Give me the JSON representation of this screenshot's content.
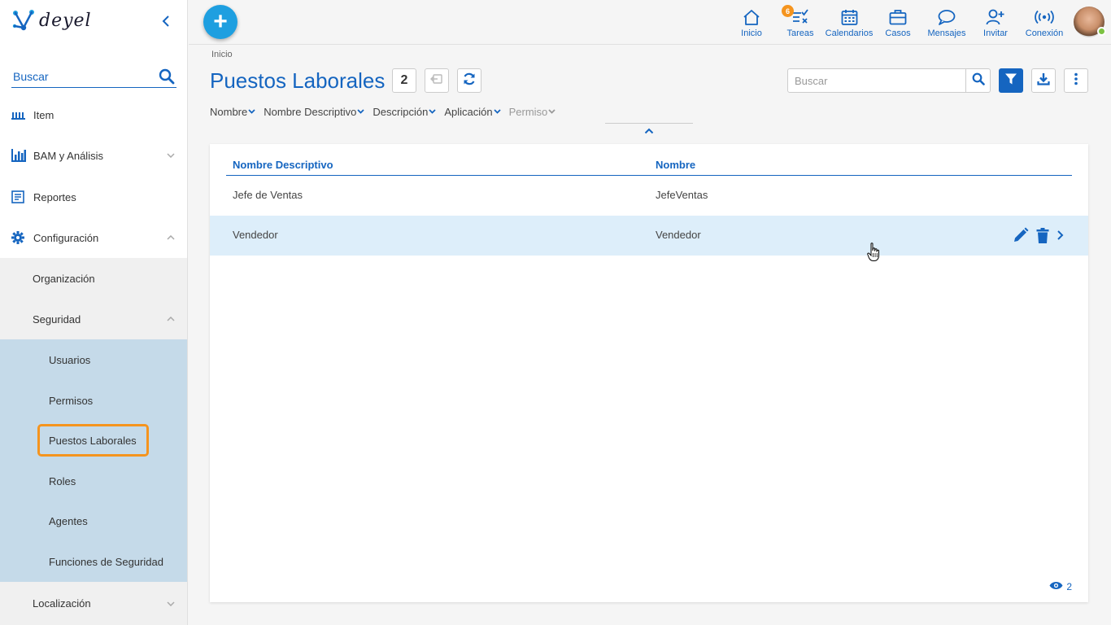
{
  "sidebar": {
    "logo_text": "deyel",
    "collapse_icon": "chevron-left-icon",
    "search_placeholder": "Buscar",
    "items": [
      {
        "label": "Item",
        "icon": "bars-icon"
      },
      {
        "label": "BAM y Análisis",
        "icon": "bar-chart-icon"
      },
      {
        "label": "Reportes",
        "icon": "report-icon"
      },
      {
        "label": "Configuración",
        "icon": "gear-icon"
      },
      {
        "label": "Organización"
      },
      {
        "label": "Seguridad"
      },
      {
        "label": "Usuarios"
      },
      {
        "label": "Permisos"
      },
      {
        "label": "Puestos Laborales"
      },
      {
        "label": "Roles"
      },
      {
        "label": "Agentes"
      },
      {
        "label": "Funciones de Seguridad"
      },
      {
        "label": "Localización"
      }
    ]
  },
  "topbar": {
    "fab_label": "+",
    "nav": [
      {
        "label": "Inicio",
        "icon": "home-icon"
      },
      {
        "label": "Tareas",
        "icon": "tasks-icon",
        "badge": "6"
      },
      {
        "label": "Calendarios",
        "icon": "calendar-icon"
      },
      {
        "label": "Casos",
        "icon": "briefcase-icon"
      },
      {
        "label": "Mensajes",
        "icon": "chat-icon"
      },
      {
        "label": "Invitar",
        "icon": "invite-user-icon"
      },
      {
        "label": "Conexión",
        "icon": "connection-icon"
      }
    ],
    "avatar_status_color": "#7cc242"
  },
  "main": {
    "breadcrumb": "Inicio",
    "title": "Puestos Laborales",
    "count": "2",
    "search_placeholder": "Buscar",
    "filters": [
      {
        "label": "Nombre",
        "enabled": true
      },
      {
        "label": "Nombre Descriptivo",
        "enabled": true
      },
      {
        "label": "Descripción",
        "enabled": true
      },
      {
        "label": "Aplicación",
        "enabled": true
      },
      {
        "label": "Permiso",
        "enabled": false
      }
    ],
    "table": {
      "columns": [
        "Nombre Descriptivo",
        "Nombre"
      ],
      "rows": [
        {
          "descriptive": "Jefe de Ventas",
          "name": "JefeVentas"
        },
        {
          "descriptive": "Vendedor",
          "name": "Vendedor"
        }
      ],
      "selected_row": 1
    },
    "view_count": "2"
  },
  "colors": {
    "accent": "#1565c0",
    "fab": "#1e9fe0",
    "badge": "#f5941e",
    "highlight": "#f5941e",
    "selected_row": "#ddeefa",
    "submenu": "#c5dae9"
  }
}
